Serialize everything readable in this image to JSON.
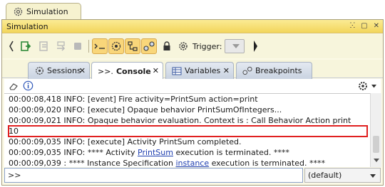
{
  "outer_tab": {
    "label": "Simulation",
    "icon": "simulation-gear-icon"
  },
  "panel": {
    "title": "Simulation",
    "title_buttons": [
      "pin-icon",
      "minimize-icon",
      "close-icon"
    ],
    "title_button_glyphs": [
      "ⵘ",
      "▢",
      "✕"
    ]
  },
  "toolbar": {
    "trigger_label": "Trigger:",
    "accent": "#f9d67a"
  },
  "tabs": [
    {
      "label": "Sessions",
      "icon": "sessions-icon",
      "close": "✕"
    },
    {
      "label": "Console",
      "icon": "console-icon",
      "close": "✕",
      "active": true,
      "prefix": ">>."
    },
    {
      "label": "Variables",
      "icon": "variables-icon",
      "close": "✕"
    },
    {
      "label": "Breakpoints",
      "icon": "breakpoints-icon",
      "close": ""
    }
  ],
  "console": {
    "lines": [
      {
        "text": "00:00:08,418 INFO: [event] Fire activity=PrintSum action=print"
      },
      {
        "text": "00:00:09,020 INFO: [execute] Opaque behavior PrintSumOfIntegers..."
      },
      {
        "text": "00:00:09,021 INFO: Opaque behavior evaluation. Context is : Call Behavior Action print"
      },
      {
        "text": "10"
      },
      {
        "text": "00:00:09,035 INFO: [execute] Activity PrintSum completed."
      },
      {
        "pre": "00:00:09,035 INFO: **** Activity ",
        "link": "PrintSum",
        "post": " execution is terminated. ****"
      },
      {
        "pre": "00:00:09,039 : **** Instance Specification ",
        "link": "instance",
        "post": " execution is terminated. ****"
      }
    ],
    "highlight_color": "#e02020"
  },
  "input": {
    "value": ">>",
    "level": "(default)"
  }
}
